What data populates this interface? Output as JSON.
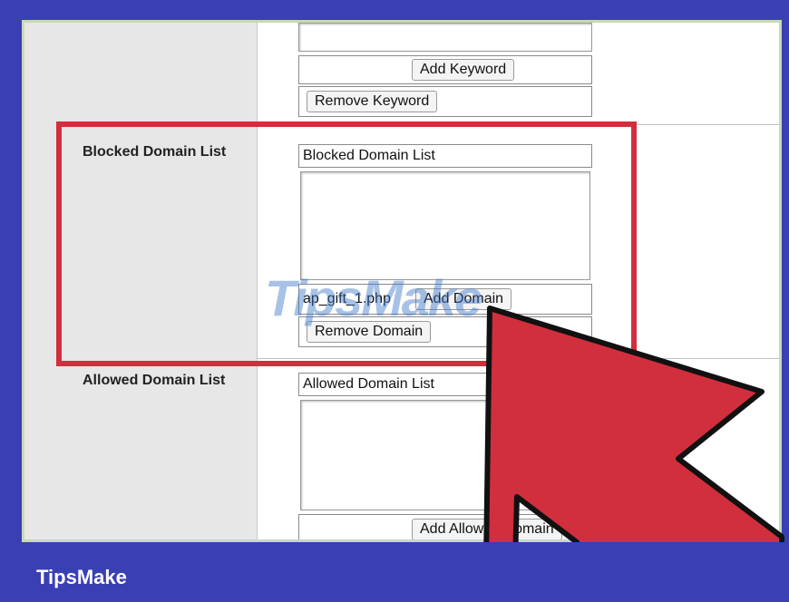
{
  "keyword_section": {
    "add_keyword_button": "Add Keyword",
    "remove_keyword_button": "Remove Keyword"
  },
  "blocked_domain": {
    "field_label": "Blocked Domain List",
    "list_header": "Blocked Domain List",
    "input_value": "ap_gift_1.php",
    "add_domain_button": "Add Domain",
    "remove_domain_button": "Remove Domain"
  },
  "allowed_domain": {
    "field_label": "Allowed Domain List",
    "list_header": "Allowed Domain List",
    "add_allowed_domain_button": "Add Allowed Domain"
  },
  "watermark": "TipsMake",
  "footer": {
    "brand": "TipsMake"
  },
  "colors": {
    "frame_blue": "#3a3fb4",
    "highlight_red": "#d12f3d",
    "label_column_gray": "#e7e7e7"
  },
  "icons": {
    "pointer": "arrow-cursor-icon"
  }
}
